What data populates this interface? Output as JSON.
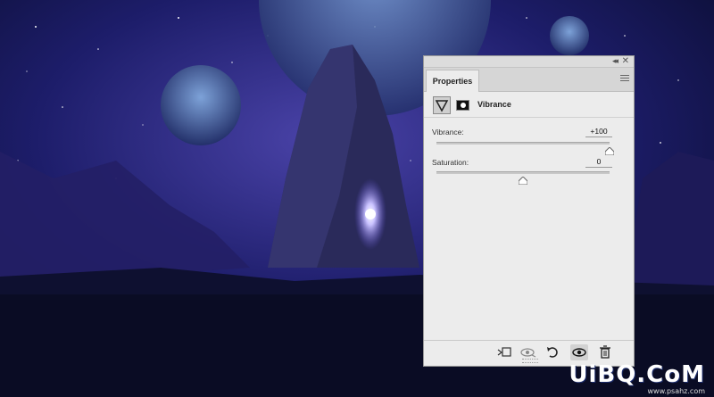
{
  "panel": {
    "tab_label": "Properties",
    "adjustment_title": "Vibrance",
    "sliders": [
      {
        "label": "Vibrance:",
        "value": "+100",
        "level": 1.0
      },
      {
        "label": "Saturation:",
        "value": "0",
        "level": 0.5
      }
    ],
    "bottom_icons": [
      "clip-to-layer-icon",
      "view-previous-state-icon",
      "reset-icon",
      "visibility-eye-icon",
      "trash-icon"
    ]
  },
  "watermark": {
    "text": "UiBQ.CoM",
    "sub": "www.psahz.com"
  }
}
